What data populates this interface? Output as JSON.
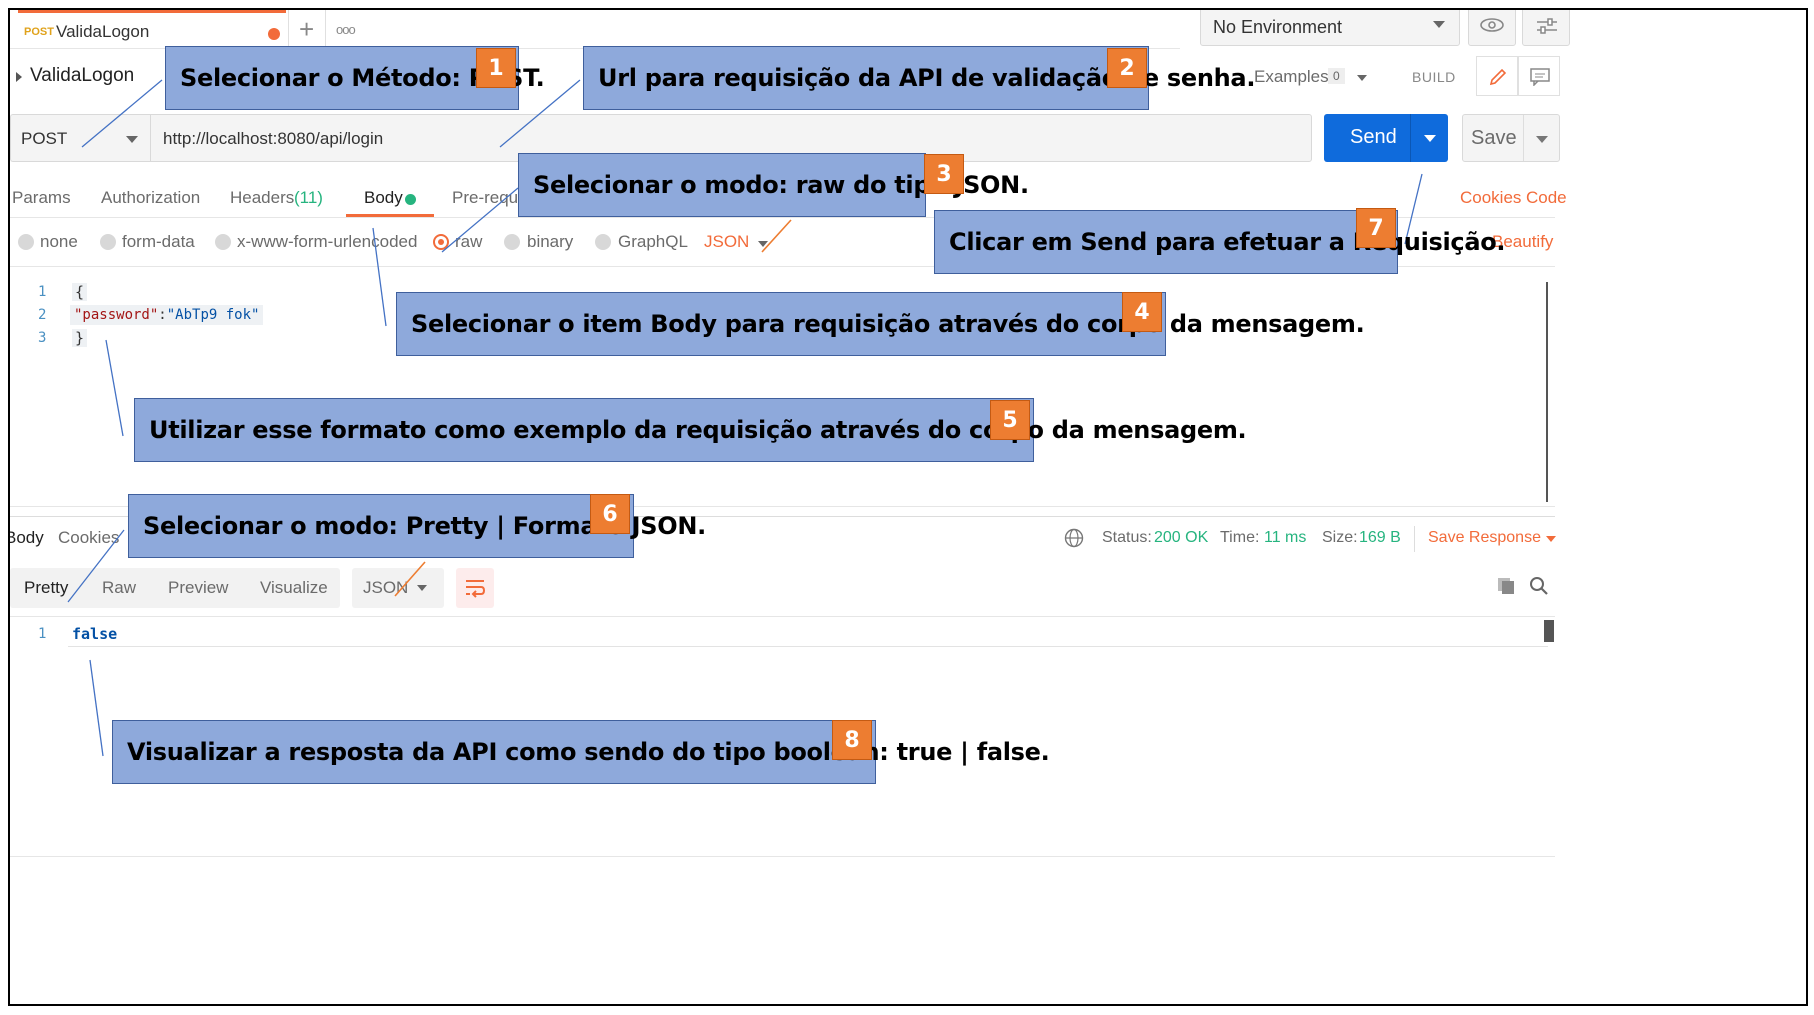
{
  "request_tab": {
    "method_badge": "POST",
    "title": "ValidaLogon"
  },
  "tab_controls": {
    "new_tab": "+",
    "more": "ooo"
  },
  "environment": {
    "selected": "No Environment"
  },
  "breadcrumb": {
    "name": "ValidaLogon"
  },
  "header_actions": {
    "examples_label": "Examples",
    "examples_count": "0",
    "build_label": "BUILD"
  },
  "request": {
    "method": "POST",
    "url": "http://localhost:8080/api/login",
    "send_label": "Send",
    "save_label": "Save"
  },
  "request_tabs": [
    {
      "label": "Params"
    },
    {
      "label": "Authorization"
    },
    {
      "label": "Headers",
      "count": "(11)"
    },
    {
      "label": "Body"
    },
    {
      "label": "Pre-reque"
    }
  ],
  "request_links": {
    "cookies": "Cookies",
    "code": "Code",
    "beautify": "Beautify"
  },
  "body_modes": [
    {
      "label": "none"
    },
    {
      "label": "form-data"
    },
    {
      "label": "x-www-form-urlencoded"
    },
    {
      "label": "raw",
      "selected": true
    },
    {
      "label": "binary"
    },
    {
      "label": "GraphQL"
    }
  ],
  "body_format": "JSON",
  "request_body": {
    "line_numbers": [
      "1",
      "2",
      "3"
    ],
    "open_brace": "{",
    "key": "\"password\"",
    "colon": ":",
    "value": "\"AbTp9 fok\"",
    "close_brace": "}"
  },
  "response_tabs": [
    {
      "label": "Body"
    },
    {
      "label": "Cookies"
    }
  ],
  "response_status": {
    "status_label": "Status:",
    "status_value": "200 OK",
    "time_label": "Time:",
    "time_value": "11 ms",
    "size_label": "Size:",
    "size_value": "169 B",
    "save_response": "Save Response"
  },
  "response_view_modes": [
    {
      "label": "Pretty"
    },
    {
      "label": "Raw"
    },
    {
      "label": "Preview"
    },
    {
      "label": "Visualize"
    }
  ],
  "response_format": "JSON",
  "response_body": {
    "line_number": "1",
    "value": "false"
  },
  "callouts": [
    {
      "number": "1",
      "text": "Selecionar o Método: POST."
    },
    {
      "number": "2",
      "text": "Url para requisição da API de validação de senha."
    },
    {
      "number": "3",
      "text": "Selecionar o modo: raw do tipo JSON."
    },
    {
      "number": "4",
      "text": "Selecionar o item Body para requisição através do corpo da mensagem."
    },
    {
      "number": "5",
      "text": "Utilizar esse formato como exemplo da requisição através do corpo da mensagem."
    },
    {
      "number": "6",
      "text": "Selecionar o modo: Pretty | Formato JSON."
    },
    {
      "number": "7",
      "text": "Clicar em Send para efetuar a Requisição."
    },
    {
      "number": "8",
      "text": "Visualizar a resposta da API como sendo do tipo boolean: true | false."
    }
  ],
  "colors": {
    "accent": "#f26b3a",
    "send_blue": "#0f6bdc",
    "status_green": "#26b47f",
    "callout_fill": "#8ea9db",
    "callout_number": "#ed7d31",
    "json_key": "#a31515",
    "json_value": "#0451a5"
  }
}
